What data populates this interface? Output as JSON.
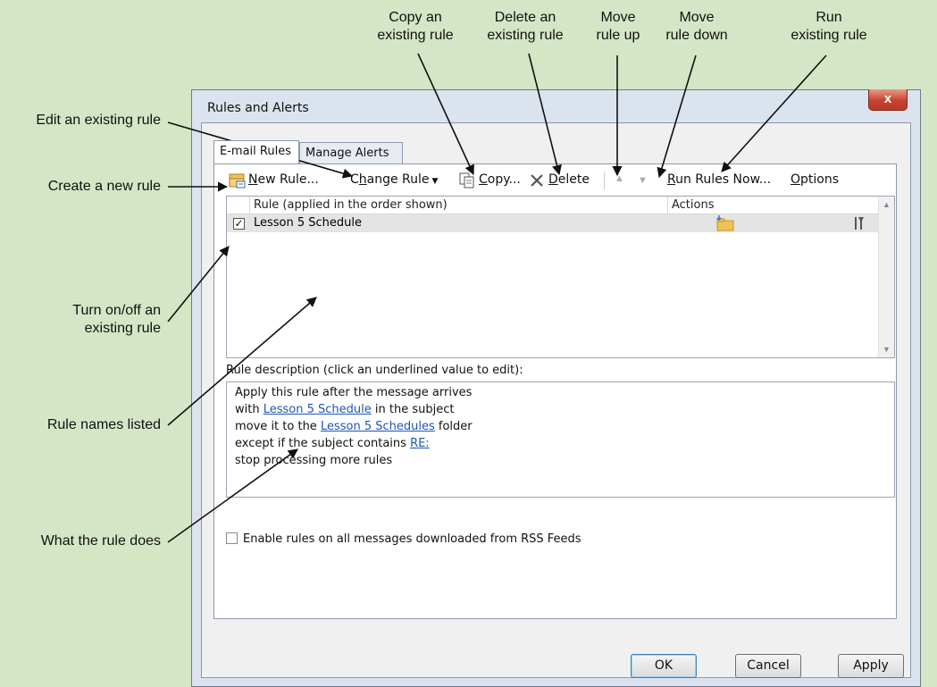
{
  "callouts": {
    "copy": [
      "Copy an",
      "existing rule"
    ],
    "delete": [
      "Delete an",
      "existing rule"
    ],
    "move_up": [
      "Move",
      "rule up"
    ],
    "move_down": [
      "Move",
      "rule down"
    ],
    "run": [
      "Run",
      "existing rule"
    ],
    "edit": "Edit an existing rule",
    "create": "Create a new rule",
    "toggle": [
      "Turn on/off an",
      "existing rule"
    ],
    "names": "Rule names listed",
    "what": "What the rule does"
  },
  "dialog": {
    "title": "Rules and Alerts",
    "close_label": "x",
    "tabs": [
      {
        "label": "E-mail Rules"
      },
      {
        "label": "Manage Alerts"
      }
    ],
    "toolbar": {
      "new_rule": {
        "u": "N",
        "rest": "ew Rule..."
      },
      "change_rule": {
        "pre": "C",
        "u": "h",
        "rest": "ange Rule"
      },
      "copy": {
        "u": "C",
        "rest": "opy..."
      },
      "delete": {
        "u": "D",
        "rest": "elete"
      },
      "run_rules": {
        "u": "R",
        "rest": "un Rules Now..."
      },
      "options": {
        "u": "O",
        "rest": "ptions"
      }
    },
    "list": {
      "columns": [
        "Rule (applied in the order shown)",
        "Actions"
      ],
      "rows": [
        {
          "name": "Lesson 5 Schedule",
          "checked": true
        }
      ]
    },
    "description": {
      "label": "Rule description (click an underlined value to edit):",
      "lines": [
        {
          "pre": "Apply this rule after the message arrives"
        },
        {
          "pre": "with ",
          "link": "Lesson 5 Schedule",
          "post": " in the subject"
        },
        {
          "pre": "move it to the ",
          "link": "Lesson 5 Schedules",
          "post": " folder"
        },
        {
          "pre": "except if the subject contains ",
          "link": "RE:"
        },
        {
          "pre": "stop processing more rules"
        }
      ]
    },
    "rss_label": "Enable rules on all messages downloaded from RSS Feeds",
    "rss_checked": false,
    "buttons": {
      "ok": "OK",
      "cancel": "Cancel",
      "apply": "Apply"
    }
  }
}
